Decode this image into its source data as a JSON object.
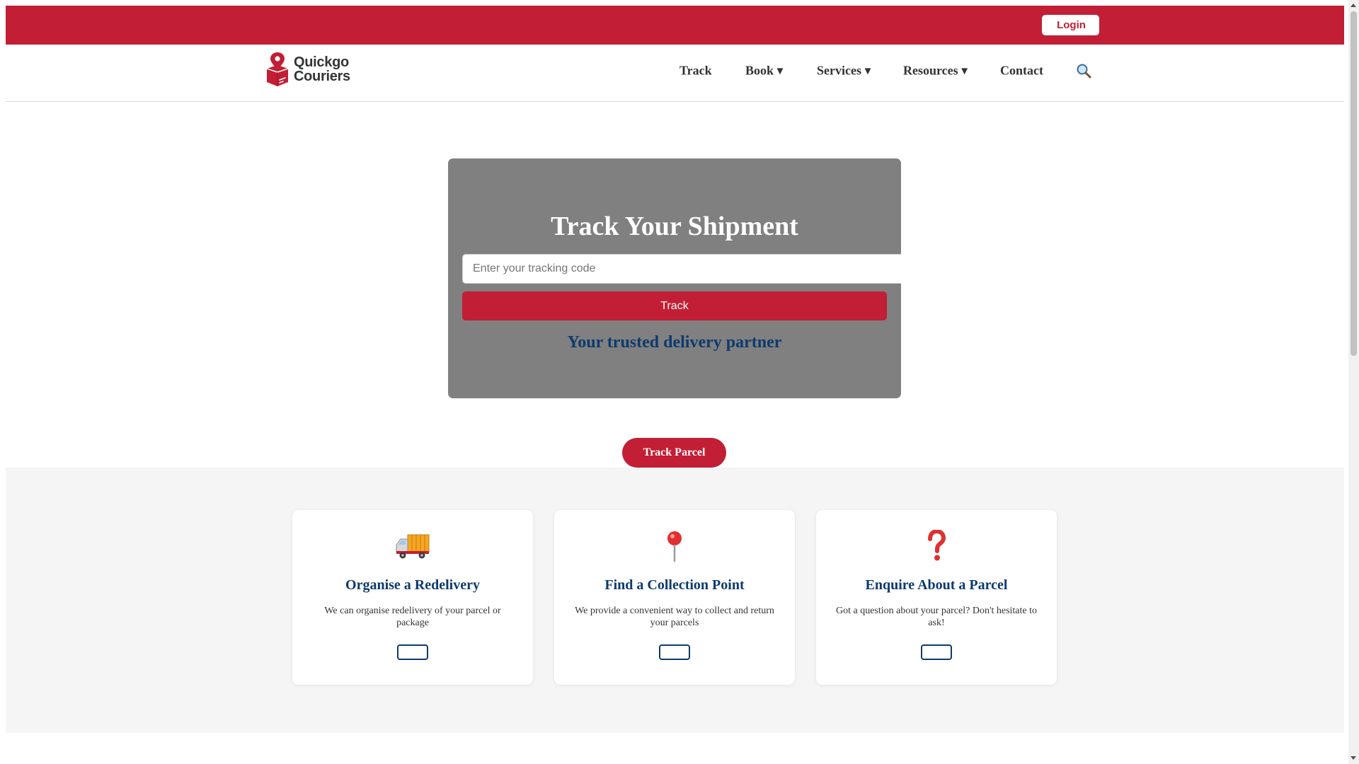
{
  "header": {
    "login_label": "Login",
    "accent_color": "#c21e35"
  },
  "brand": {
    "line1": "Quickgo",
    "line2": "Couriers",
    "logo_icon": "map-pin-box-icon"
  },
  "nav": {
    "items": [
      {
        "label": "Track"
      },
      {
        "label": "Book ▾"
      },
      {
        "label": "Services ▾"
      },
      {
        "label": "Resources ▾"
      },
      {
        "label": "Contact"
      }
    ],
    "search_icon": "🔍"
  },
  "hero": {
    "title": "Track Your Shipment",
    "input_placeholder": "Enter your tracking code",
    "input_value": "",
    "button_label": "Track",
    "tagline": "Your trusted delivery partner"
  },
  "cta": {
    "track_parcel_label": "Track Parcel"
  },
  "services": {
    "cards": [
      {
        "icon": "🚚",
        "icon_name": "delivery-truck-icon",
        "title": "Organise a Redelivery",
        "description": "We can organise redelivery of your parcel or package",
        "button_label": ""
      },
      {
        "icon": "📍",
        "icon_name": "location-pin-icon",
        "title": "Find a Collection Point",
        "description": "We provide a convenient way to collect and return your parcels",
        "button_label": ""
      },
      {
        "icon": "❓",
        "icon_name": "question-mark-icon",
        "title": "Enquire About a Parcel",
        "description": "Got a question about your parcel? Don't hesitate to ask!",
        "button_label": ""
      }
    ]
  },
  "colors": {
    "brand_red": "#c21e35",
    "navy": "#0d3a6e",
    "hero_grey": "#808080",
    "section_bg": "#f5f5f5"
  }
}
